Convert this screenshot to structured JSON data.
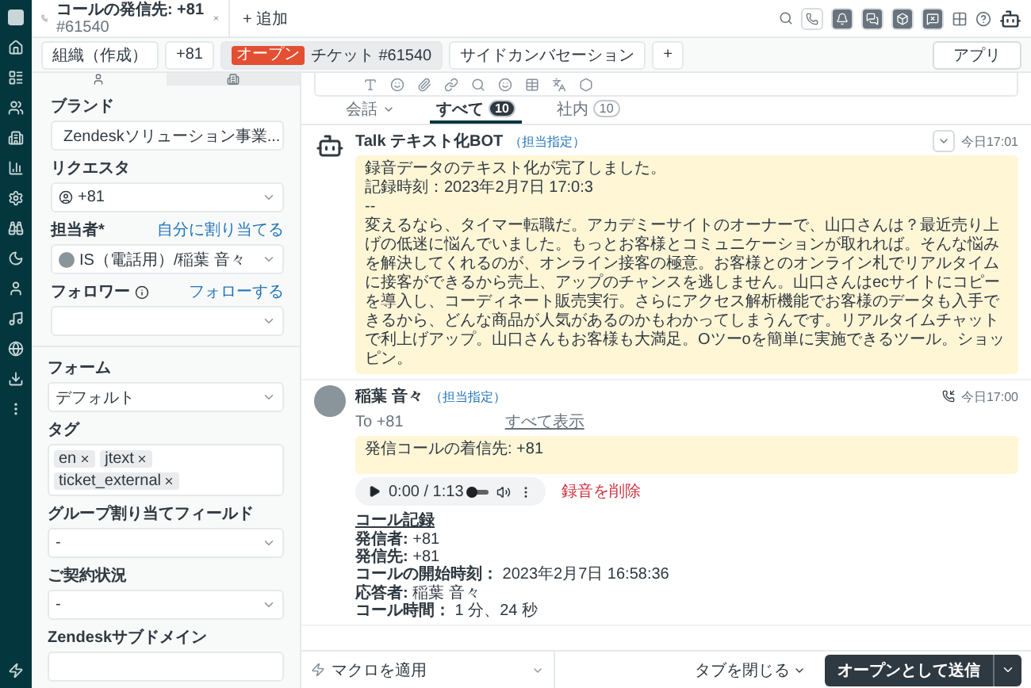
{
  "header": {
    "tab": {
      "title": "コールの発信先: +81",
      "subtitle": "#61540"
    },
    "add_label": "+ 追加"
  },
  "breadcrumb": [
    {
      "label": "組織（作成）",
      "selected": false
    },
    {
      "label": "+81",
      "selected": false
    },
    {
      "label": "チケット #61540",
      "badge": "オープン",
      "selected": true
    },
    {
      "label": "サイドカンバセーション",
      "selected": false
    }
  ],
  "breadcrumb_add": "+",
  "apps_button": "アプリ",
  "properties": {
    "tabs": [
      {
        "selected": false
      },
      {
        "selected": true
      }
    ],
    "ticket_fields": [
      {
        "kind": "select",
        "label": "ブランド",
        "value": "Zendeskソリューション事業..."
      },
      {
        "kind": "select",
        "label": "リクエスタ",
        "value": "+81"
      },
      {
        "kind": "select",
        "label": "担当者*",
        "value": "IS（電話用）/稲葉 音々",
        "link": "自分に割り当てる"
      },
      {
        "kind": "select",
        "label": "フォロワー",
        "link": "フォローする",
        "info": true
      }
    ],
    "form_fields": [
      {
        "kind": "select",
        "label": "フォーム",
        "value": "デフォルト"
      },
      {
        "kind": "tags",
        "label": "タグ",
        "tags": [
          "en",
          "jtext",
          "ticket_external"
        ]
      },
      {
        "kind": "select",
        "label": "グループ割り当てフィールド",
        "value": "-"
      },
      {
        "kind": "select",
        "label": "ご契約状況",
        "value": "-"
      },
      {
        "kind": "input",
        "label": "Zendeskサブドメイン"
      }
    ]
  },
  "filters": [
    {
      "label": "会話",
      "selected": false,
      "dropdown": true
    },
    {
      "label": "すべて",
      "count": "10",
      "selected": true
    },
    {
      "label": "社内",
      "count": "10",
      "selected": false
    }
  ],
  "messages": [
    {
      "kind": "bot",
      "author": "Talk テキスト化BOT",
      "tag": "（担当指定）",
      "time": "今日17:01",
      "body": [
        "録音データのテキスト化が完了しました。",
        "記録時刻：2023年2月7日 17:0:3",
        "--",
        "変えるなら、タイマー転職だ。アカデミーサイトのオーナーで、山口さんは？最近売り上げの低迷に悩んでいました。もっとお客様とコミュニケーションが取れれば。そんな悩みを解決してくれるのが、オンライン接客の極意。お客様とのオンライン札でリアルタイムに接客ができるから売上、アップのチャンスを逃しません。山口さんはecサイトにコピーを導入し、コーディネート販売実行。さらにアクセス解析機能でお客様のデータも入手できるから、どんな商品が人気があるのかもわかってしまうんです。リアルタイムチャットで利上げアップ。山口さんもお客様も大満足。Oツーoを簡単に実施できるツール。ショッピン。"
      ]
    },
    {
      "kind": "call",
      "author": "稲葉 音々",
      "tag": "（担当指定）",
      "to": "To +81",
      "show_all": "すべて表示",
      "time": "今日17:00",
      "body": [
        "発信コールの着信先: +81"
      ],
      "audio": {
        "time": "0:00 / 1:13",
        "level": 0
      },
      "delete": "録音を削除",
      "record_title": "コール記録",
      "record": [
        "**発信者:** +81",
        "**発信先:** +81",
        "**コールの開始時刻：** 2023年2月7日 16:58:36",
        "**応答者:** 稲葉 音々",
        "**コール時間：** 1 分、24 秒"
      ]
    }
  ],
  "footer": {
    "macro": "マクロを適用",
    "close_tab": "タブを閉じる",
    "submit": "オープンとして送信"
  }
}
